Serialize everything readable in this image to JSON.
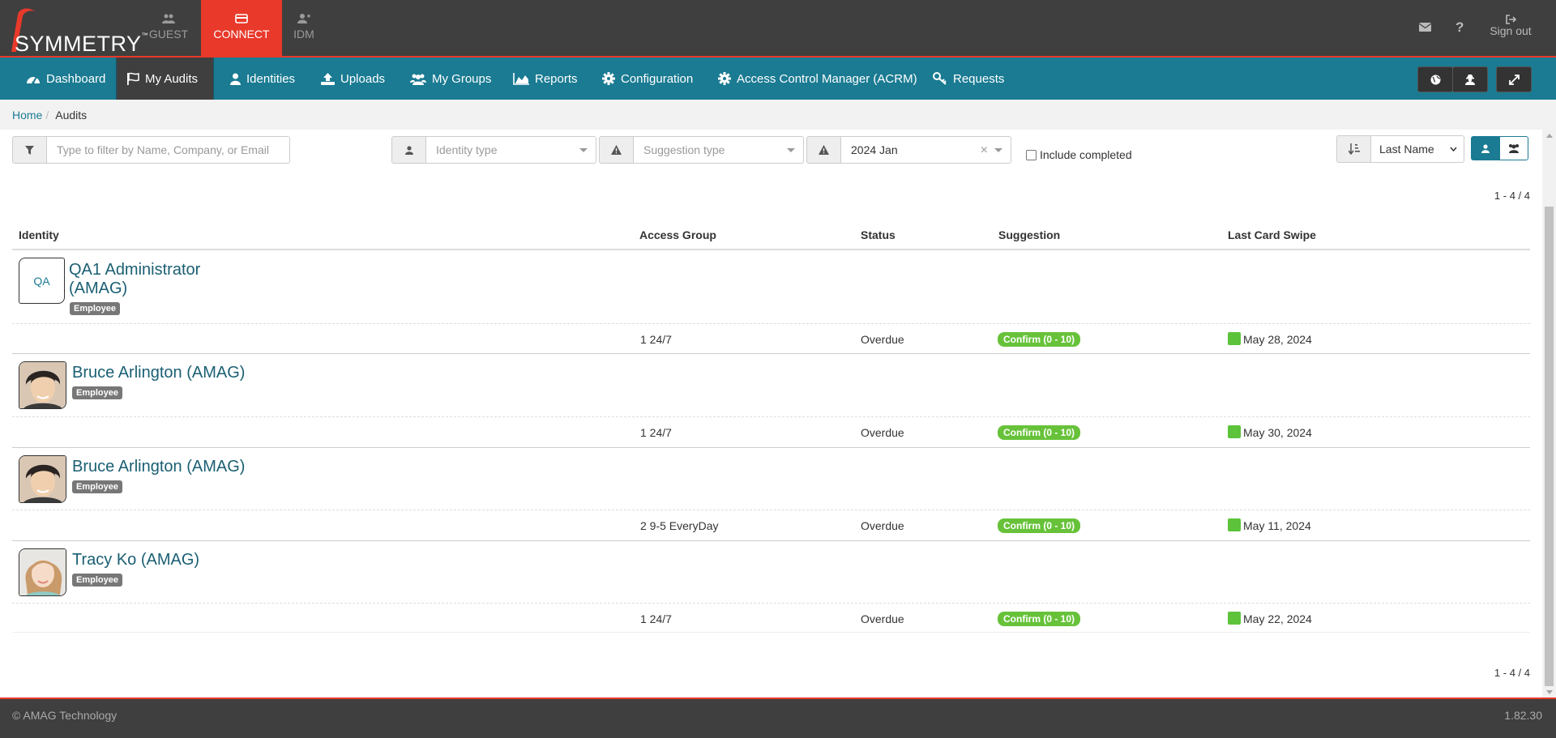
{
  "brand": {
    "logo_text": "SYMMETRY",
    "tm": "™"
  },
  "apps": [
    {
      "label": "GUEST",
      "icon": "group-icon"
    },
    {
      "label": "CONNECT",
      "icon": "card-icon",
      "active": true
    },
    {
      "label": "IDM",
      "icon": "user-add-icon"
    }
  ],
  "topright": {
    "mail_icon": "envelope-icon",
    "help_icon": "question-icon",
    "signout_label": "Sign out"
  },
  "nav": [
    {
      "label": "Dashboard",
      "icon": "dashboard-icon"
    },
    {
      "label": "My Audits",
      "icon": "flag-icon",
      "active": true
    },
    {
      "label": "Identities",
      "icon": "user-icon"
    },
    {
      "label": "Uploads",
      "icon": "upload-icon"
    },
    {
      "label": "My Groups",
      "icon": "group-icon"
    },
    {
      "label": "Reports",
      "icon": "area-chart-icon"
    },
    {
      "label": "Configuration",
      "icon": "gear-icon"
    },
    {
      "label": "Access Control Manager (ACRM)",
      "icon": "gear-icon"
    },
    {
      "label": "Requests",
      "icon": "key-icon"
    }
  ],
  "breadcrumb": {
    "home": "Home",
    "current": "Audits"
  },
  "filters": {
    "search_placeholder": "Type to filter by Name, Company, or Email",
    "identity_type_placeholder": "Identity type",
    "suggestion_type_placeholder": "Suggestion type",
    "period_value": "2024 Jan",
    "clear": "×",
    "include_completed": "Include completed",
    "sort_value": "Last Name"
  },
  "pagination": {
    "top": "1 - 4 / 4",
    "bottom": "1 - 4 / 4"
  },
  "table": {
    "headers": {
      "identity": "Identity",
      "access_group": "Access Group",
      "status": "Status",
      "suggestion": "Suggestion",
      "last_swipe": "Last Card Swipe"
    },
    "rows": [
      {
        "name_line1": "QA1 Administrator",
        "name_line2": "(AMAG)",
        "initials": "QA",
        "tag": "Employee",
        "access_group": "1 24/7",
        "status": "Overdue",
        "suggestion": "Confirm (0 - 10)",
        "last_swipe": "May 28, 2024"
      },
      {
        "name": "Bruce Arlington (AMAG)",
        "tag": "Employee",
        "access_group": "1 24/7",
        "status": "Overdue",
        "suggestion": "Confirm (0 - 10)",
        "last_swipe": "May 30, 2024"
      },
      {
        "name": "Bruce Arlington (AMAG)",
        "tag": "Employee",
        "access_group": "2 9-5 EveryDay",
        "status": "Overdue",
        "suggestion": "Confirm (0 - 10)",
        "last_swipe": "May 11, 2024"
      },
      {
        "name": "Tracy Ko (AMAG)",
        "tag": "Employee",
        "access_group": "1 24/7",
        "status": "Overdue",
        "suggestion": "Confirm (0 - 10)",
        "last_swipe": "May 22, 2024"
      }
    ]
  },
  "footer": {
    "copyright": "© AMAG Technology",
    "version": "1.82.30"
  },
  "colors": {
    "topbar": "#3f3f3f",
    "accent": "#e8392a",
    "nav": "#1a7b92",
    "badge": "#67c23a"
  }
}
